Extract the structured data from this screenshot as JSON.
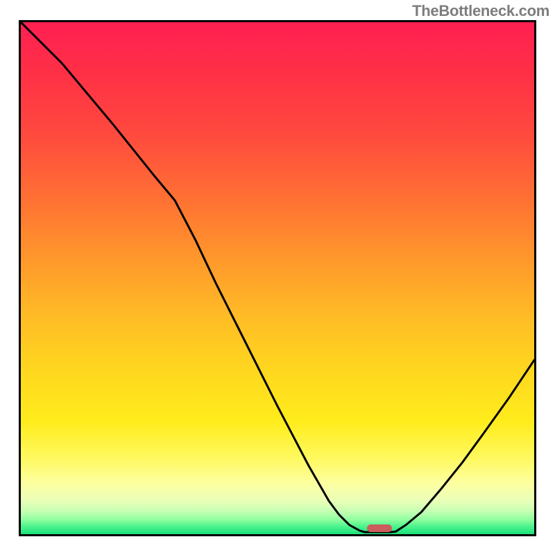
{
  "watermark": "TheBottleneck.com",
  "chart_data": {
    "type": "line",
    "title": "",
    "xlabel": "",
    "ylabel": "",
    "x_range": [
      0,
      100
    ],
    "y_range": [
      0,
      100
    ],
    "series": [
      {
        "name": "curve",
        "points": [
          {
            "x": 0,
            "y": 100.0
          },
          {
            "x": 8,
            "y": 92.0
          },
          {
            "x": 18,
            "y": 80.0
          },
          {
            "x": 26,
            "y": 70.0
          },
          {
            "x": 30,
            "y": 65.2
          },
          {
            "x": 34,
            "y": 57.5
          },
          {
            "x": 38,
            "y": 49.0
          },
          {
            "x": 44,
            "y": 37.0
          },
          {
            "x": 50,
            "y": 25.0
          },
          {
            "x": 56,
            "y": 13.5
          },
          {
            "x": 60,
            "y": 6.5
          },
          {
            "x": 62,
            "y": 3.8
          },
          {
            "x": 64,
            "y": 1.8
          },
          {
            "x": 66,
            "y": 0.7
          },
          {
            "x": 67,
            "y": 0.4
          },
          {
            "x": 69,
            "y": 0.4
          },
          {
            "x": 72,
            "y": 0.4
          },
          {
            "x": 73,
            "y": 0.5
          },
          {
            "x": 75,
            "y": 1.8
          },
          {
            "x": 78,
            "y": 4.3
          },
          {
            "x": 82,
            "y": 9.0
          },
          {
            "x": 86,
            "y": 14.0
          },
          {
            "x": 90,
            "y": 19.5
          },
          {
            "x": 95,
            "y": 26.5
          },
          {
            "x": 100,
            "y": 34.0
          }
        ]
      }
    ],
    "marker": {
      "x": 69.8,
      "y": 0.7
    },
    "gradient_stops": [
      {
        "offset": 0,
        "color": "#ff2052"
      },
      {
        "offset": 0.1,
        "color": "#ff3046"
      },
      {
        "offset": 0.22,
        "color": "#ff4a3e"
      },
      {
        "offset": 0.35,
        "color": "#ff7233"
      },
      {
        "offset": 0.47,
        "color": "#ff9a2b"
      },
      {
        "offset": 0.58,
        "color": "#ffbd25"
      },
      {
        "offset": 0.68,
        "color": "#ffd71f"
      },
      {
        "offset": 0.78,
        "color": "#ffec1c"
      },
      {
        "offset": 0.85,
        "color": "#fff95e"
      },
      {
        "offset": 0.9,
        "color": "#fdffa0"
      },
      {
        "offset": 0.935,
        "color": "#e9ffb8"
      },
      {
        "offset": 0.955,
        "color": "#c6ffb3"
      },
      {
        "offset": 0.972,
        "color": "#8eff9f"
      },
      {
        "offset": 0.985,
        "color": "#4cf38d"
      },
      {
        "offset": 1.0,
        "color": "#1ce07a"
      }
    ]
  }
}
